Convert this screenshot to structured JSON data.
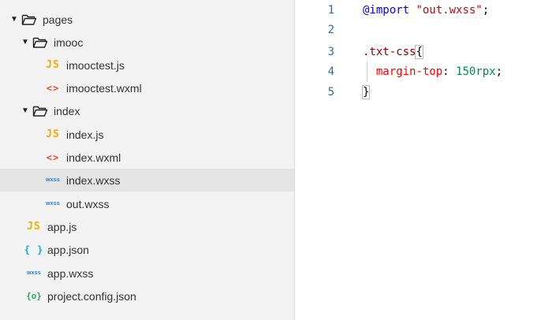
{
  "sidebar": {
    "rows": [
      {
        "label": "pages",
        "kind": "folder",
        "depth": 0,
        "expanded": true
      },
      {
        "label": "imooc",
        "kind": "folder",
        "depth": 1,
        "expanded": true
      },
      {
        "label": "imooctest.js",
        "kind": "js",
        "depth": 2,
        "icon_text": "JS"
      },
      {
        "label": "imooctest.wxml",
        "kind": "wxml",
        "depth": 2,
        "icon_text": "<>"
      },
      {
        "label": "index",
        "kind": "folder",
        "depth": 1,
        "expanded": true
      },
      {
        "label": "index.js",
        "kind": "js",
        "depth": 2,
        "icon_text": "JS"
      },
      {
        "label": "index.wxml",
        "kind": "wxml",
        "depth": 2,
        "icon_text": "<>"
      },
      {
        "label": "index.wxss",
        "kind": "wxss",
        "depth": 2,
        "icon_text": "wxss",
        "selected": true
      },
      {
        "label": "out.wxss",
        "kind": "wxss",
        "depth": 2,
        "icon_text": "wxss"
      },
      {
        "label": "app.js",
        "kind": "js",
        "depth": 1,
        "icon_text": "JS"
      },
      {
        "label": "app.json",
        "kind": "json",
        "depth": 1,
        "icon_text": "{ }"
      },
      {
        "label": "app.wxss",
        "kind": "wxss",
        "depth": 1,
        "icon_text": "wxss"
      },
      {
        "label": "project.config.json",
        "kind": "config",
        "depth": 1,
        "icon_text": "{o}"
      }
    ]
  },
  "editor": {
    "lines": [
      {
        "number": "1",
        "tokens": [
          {
            "t": "@import",
            "c": "at-rule"
          },
          {
            "t": " ",
            "c": "punct"
          },
          {
            "t": "\"out.wxss\"",
            "c": "string"
          },
          {
            "t": ";",
            "c": "punct"
          }
        ]
      },
      {
        "number": "2",
        "tokens": []
      },
      {
        "number": "3",
        "tokens": [
          {
            "t": ".txt-css",
            "c": "selector"
          },
          {
            "t": "{",
            "c": "punct brace-match"
          }
        ]
      },
      {
        "number": "4",
        "tokens": [
          {
            "t": "  ",
            "c": "punct"
          },
          {
            "t": "margin-top",
            "c": "property"
          },
          {
            "t": ": ",
            "c": "punct"
          },
          {
            "t": "150rpx",
            "c": "value"
          },
          {
            "t": ";",
            "c": "punct"
          }
        ],
        "indent_guide": true
      },
      {
        "number": "5",
        "tokens": [
          {
            "t": "}",
            "c": "punct brace-match"
          }
        ]
      }
    ]
  },
  "colors": {
    "sidebar_bg": "#f3f3f3",
    "selected_row_bg": "#e4e4e4",
    "line_number": "#2e6f9e",
    "js_icon": "#f0ad00",
    "wxml_icon": "#e44d26",
    "wxss_icon": "#2f7bbf",
    "json_icon": "#1da7d9",
    "config_icon": "#2ba36b"
  },
  "icons": {
    "folder": "folder-open-icon",
    "caret": "caret-down-icon",
    "js": "js-file-icon",
    "wxml": "wxml-file-icon",
    "wxss": "wxss-file-icon",
    "json": "json-file-icon",
    "config": "config-file-icon"
  }
}
